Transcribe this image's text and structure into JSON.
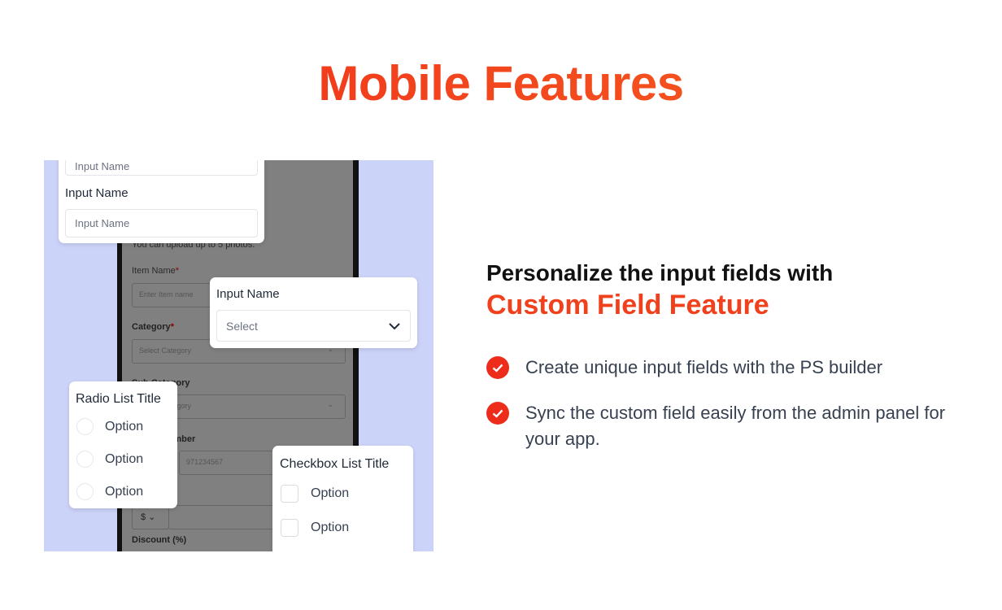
{
  "title": "Mobile Features",
  "heading": {
    "line1": "Personalize the input fields with",
    "line2": "Custom Field Feature"
  },
  "bullets": [
    "Create unique input fields with the PS builder",
    "Sync the custom field easily from the admin panel for your app."
  ],
  "colors": {
    "accent": "#ef2b1b",
    "panel_bg": "#ccd3f9"
  },
  "phone": {
    "upload_note": "You can upload up to 5 photos.",
    "item_label": "Item Name",
    "item_placeholder": "Enter Item name",
    "category_label": "Category",
    "category_placeholder": "Select Category",
    "subcategory_label": "Sub Category",
    "subcategory_placeholder": "Select Category",
    "phone_label": "Phone Number",
    "phone_value": "971234567",
    "currency": "$",
    "discount_label": "Discount (%)",
    "required": "*"
  },
  "input_card": {
    "top_placeholder": "Input Name",
    "label": "Input Name",
    "placeholder": "Input Name"
  },
  "select_card": {
    "label": "Input Name",
    "value": "Select"
  },
  "radio_card": {
    "title": "Radio List Title",
    "options": [
      "Option",
      "Option",
      "Option"
    ]
  },
  "checkbox_card": {
    "title": "Checkbox List Title",
    "options": [
      "Option",
      "Option"
    ]
  }
}
